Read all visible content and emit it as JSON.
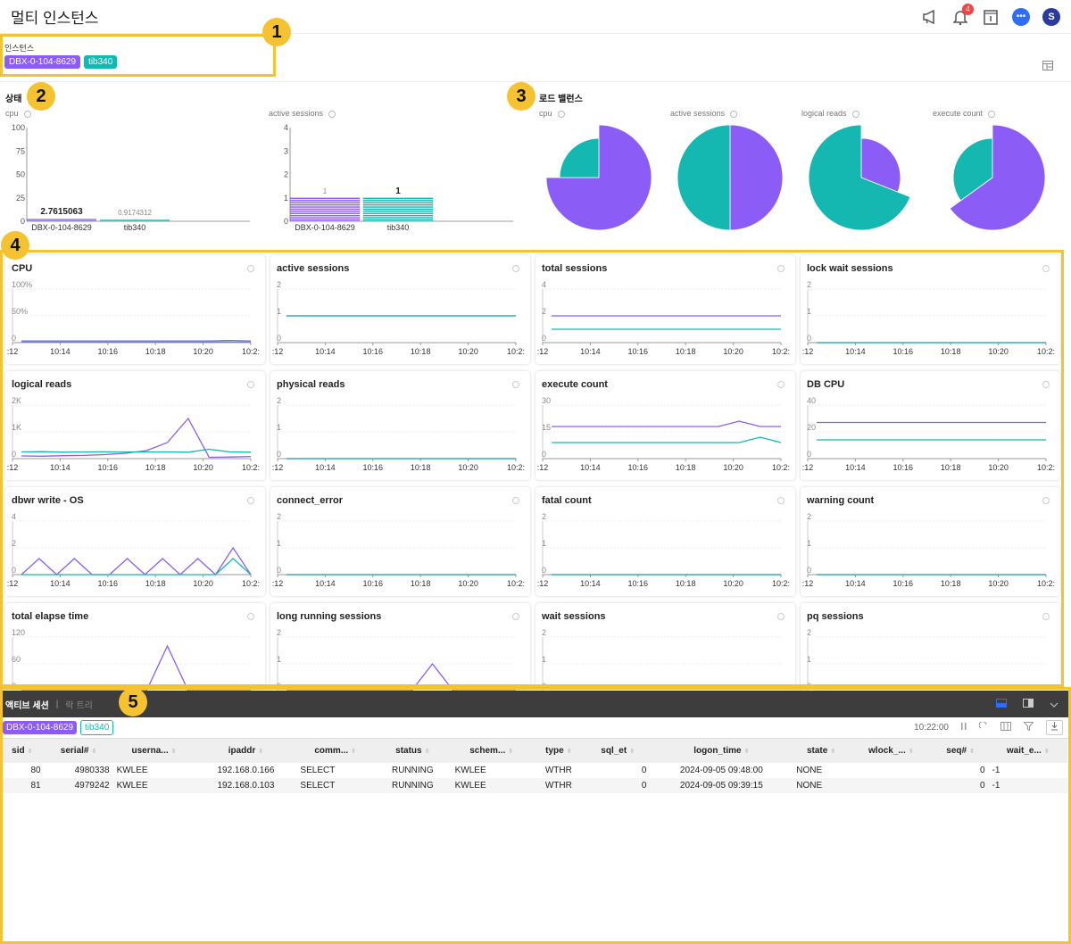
{
  "header": {
    "title": "멀티 인스턴스",
    "notification_count": "4",
    "avatar_letter": "S",
    "chat_glyph": "•••"
  },
  "instances": {
    "label": "인스턴스",
    "tags": [
      "DBX-0-104-8629",
      "tib340"
    ]
  },
  "colors": {
    "purple": "#8b5cf6",
    "teal": "#14b8b0",
    "callout": "#f5c232"
  },
  "callouts": [
    "1",
    "2",
    "3",
    "4",
    "5"
  ],
  "status": {
    "title": "상태",
    "cpu": {
      "label": "cpu",
      "yticks": [
        "100",
        "75",
        "50",
        "25",
        "0"
      ],
      "ymax": 100,
      "categories": [
        "DBX-0-104-8629",
        "tib340"
      ],
      "values": [
        2.7615063,
        0.9174312
      ],
      "value_labels": [
        "2.7615063",
        "0.9174312"
      ]
    },
    "active": {
      "label": "active sessions",
      "yticks": [
        "4",
        "3",
        "2",
        "1",
        "0"
      ],
      "ymax": 4,
      "categories": [
        "DBX-0-104-8629",
        "tib340"
      ],
      "values": [
        1,
        1
      ],
      "value_labels": [
        "1",
        "1"
      ]
    }
  },
  "load_balance": {
    "title": "로드 밸런스",
    "pies": [
      {
        "label": "cpu",
        "purple_fraction": 0.75
      },
      {
        "label": "active sessions",
        "purple_fraction": 0.5
      },
      {
        "label": "logical reads",
        "purple_fraction": 0.31
      },
      {
        "label": "execute count",
        "purple_fraction": 0.65
      }
    ]
  },
  "chart_data": [
    {
      "type": "line",
      "title": "CPU",
      "yticks": [
        "100%",
        "50%",
        "0"
      ],
      "ymax": 100,
      "xticks": [
        ":12",
        "10:14",
        "10:16",
        "10:18",
        "10:20",
        "10:2:"
      ],
      "series": [
        {
          "name": "DBX-0-104-8629",
          "values": [
            3,
            3,
            3,
            3,
            3,
            3,
            3,
            3,
            3,
            3,
            4,
            3
          ]
        },
        {
          "name": "tib340",
          "values": [
            1,
            1,
            1,
            1,
            1,
            1,
            1,
            1,
            1,
            1,
            1,
            1
          ]
        }
      ]
    },
    {
      "type": "line",
      "title": "active sessions",
      "yticks": [
        "2",
        "1",
        "0"
      ],
      "ymax": 2,
      "xticks": [
        ":12",
        "10:14",
        "10:16",
        "10:18",
        "10:20",
        "10:2:"
      ],
      "series": [
        {
          "name": "DBX-0-104-8629",
          "values": [
            1,
            1,
            1,
            1,
            1,
            1,
            1,
            1,
            1,
            1,
            1,
            1
          ]
        },
        {
          "name": "tib340",
          "values": [
            1,
            1,
            1,
            1,
            1,
            1,
            1,
            1,
            1,
            1,
            1,
            1
          ]
        }
      ]
    },
    {
      "type": "line",
      "title": "total sessions",
      "yticks": [
        "4",
        "2",
        "0"
      ],
      "ymax": 4,
      "xticks": [
        ":12",
        "10:14",
        "10:16",
        "10:18",
        "10:20",
        "10:2:"
      ],
      "series": [
        {
          "name": "DBX-0-104-8629",
          "values": [
            2,
            2,
            2,
            2,
            2,
            2,
            2,
            2,
            2,
            2,
            2,
            2
          ]
        },
        {
          "name": "tib340",
          "values": [
            1,
            1,
            1,
            1,
            1,
            1,
            1,
            1,
            1,
            1,
            1,
            1
          ]
        }
      ]
    },
    {
      "type": "line",
      "title": "lock wait sessions",
      "yticks": [
        "2",
        "1",
        "0"
      ],
      "ymax": 2,
      "xticks": [
        ":12",
        "10:14",
        "10:16",
        "10:18",
        "10:20",
        "10:2:"
      ],
      "series": [
        {
          "name": "DBX-0-104-8629",
          "values": [
            0,
            0,
            0,
            0,
            0,
            0,
            0,
            0,
            0,
            0,
            0,
            0
          ]
        },
        {
          "name": "tib340",
          "values": [
            0,
            0,
            0,
            0,
            0,
            0,
            0,
            0,
            0,
            0,
            0,
            0
          ]
        }
      ]
    },
    {
      "type": "line",
      "title": "logical reads",
      "yticks": [
        "2K",
        "1K",
        "0"
      ],
      "ymax": 2000,
      "xticks": [
        ":12",
        "10:14",
        "10:16",
        "10:18",
        "10:20",
        "10:2:"
      ],
      "series": [
        {
          "name": "DBX-0-104-8629",
          "values": [
            100,
            90,
            110,
            120,
            150,
            200,
            300,
            600,
            1500,
            50,
            60,
            80
          ]
        },
        {
          "name": "tib340",
          "values": [
            250,
            260,
            240,
            250,
            255,
            245,
            250,
            250,
            240,
            350,
            250,
            240
          ]
        }
      ]
    },
    {
      "type": "line",
      "title": "physical reads",
      "yticks": [
        "2",
        "1",
        "0"
      ],
      "ymax": 2,
      "xticks": [
        ":12",
        "10:14",
        "10:16",
        "10:18",
        "10:20",
        "10:2:"
      ],
      "series": [
        {
          "name": "DBX-0-104-8629",
          "values": [
            0,
            0,
            0,
            0,
            0,
            0,
            0,
            0,
            0,
            0,
            0,
            0
          ]
        },
        {
          "name": "tib340",
          "values": [
            0,
            0,
            0,
            0,
            0,
            0,
            0,
            0,
            0,
            0,
            0,
            0
          ]
        }
      ]
    },
    {
      "type": "line",
      "title": "execute count",
      "yticks": [
        "30",
        "15",
        "0"
      ],
      "ymax": 30,
      "xticks": [
        ":12",
        "10:14",
        "10:16",
        "10:18",
        "10:20",
        "10:2:"
      ],
      "series": [
        {
          "name": "DBX-0-104-8629",
          "values": [
            18,
            18,
            18,
            18,
            18,
            18,
            18,
            18,
            18,
            21,
            18,
            18
          ]
        },
        {
          "name": "tib340",
          "values": [
            9,
            9,
            9,
            9,
            9,
            9,
            9,
            9,
            9,
            9,
            12,
            9
          ]
        }
      ]
    },
    {
      "type": "line",
      "title": "DB CPU",
      "yticks": [
        "40",
        "20",
        "0"
      ],
      "ymax": 40,
      "xticks": [
        ":12",
        "10:14",
        "10:16",
        "10:18",
        "10:20",
        "10:2:"
      ],
      "series": [
        {
          "name": "DBX-0-104-8629",
          "values": [
            27,
            27,
            27,
            27,
            27,
            27,
            27,
            27,
            27,
            27,
            27,
            27
          ]
        },
        {
          "name": "tib340",
          "values": [
            14,
            14,
            14,
            14,
            14,
            14,
            14,
            14,
            14,
            14,
            14,
            14
          ]
        }
      ]
    },
    {
      "type": "line",
      "title": "dbwr write - OS",
      "yticks": [
        "4",
        "2",
        "0"
      ],
      "ymax": 4,
      "xticks": [
        ":12",
        "10:14",
        "10:16",
        "10:18",
        "10:20",
        "10:2:"
      ],
      "series": [
        {
          "name": "DBX-0-104-8629",
          "values": [
            0,
            1.2,
            0,
            1.2,
            0,
            0,
            1.2,
            0,
            1.2,
            0,
            1.2,
            0,
            2,
            0
          ]
        },
        {
          "name": "tib340",
          "values": [
            0,
            0,
            0,
            0,
            0,
            0,
            0,
            0,
            0,
            0,
            0,
            0,
            1.2,
            0
          ]
        }
      ]
    },
    {
      "type": "line",
      "title": "connect_error",
      "yticks": [
        "2",
        "1",
        "0"
      ],
      "ymax": 2,
      "xticks": [
        ":12",
        "10:14",
        "10:16",
        "10:18",
        "10:20",
        "10:2:"
      ],
      "series": [
        {
          "name": "DBX-0-104-8629",
          "values": [
            0,
            0,
            0,
            0,
            0,
            0,
            0,
            0,
            0,
            0,
            0,
            0
          ]
        },
        {
          "name": "tib340",
          "values": [
            0,
            0,
            0,
            0,
            0,
            0,
            0,
            0,
            0,
            0,
            0,
            0
          ]
        }
      ]
    },
    {
      "type": "line",
      "title": "fatal count",
      "yticks": [
        "2",
        "1",
        "0"
      ],
      "ymax": 2,
      "xticks": [
        ":12",
        "10:14",
        "10:16",
        "10:18",
        "10:20",
        "10:2:"
      ],
      "series": [
        {
          "name": "DBX-0-104-8629",
          "values": [
            0,
            0,
            0,
            0,
            0,
            0,
            0,
            0,
            0,
            0,
            0,
            0
          ]
        },
        {
          "name": "tib340",
          "values": [
            0,
            0,
            0,
            0,
            0,
            0,
            0,
            0,
            0,
            0,
            0,
            0
          ]
        }
      ]
    },
    {
      "type": "line",
      "title": "warning count",
      "yticks": [
        "2",
        "1",
        "0"
      ],
      "ymax": 2,
      "xticks": [
        ":12",
        "10:14",
        "10:16",
        "10:18",
        "10:20",
        "10:2:"
      ],
      "series": [
        {
          "name": "DBX-0-104-8629",
          "values": [
            0,
            0,
            0,
            0,
            0,
            0,
            0,
            0,
            0,
            0,
            0,
            0
          ]
        },
        {
          "name": "tib340",
          "values": [
            0,
            0,
            0,
            0,
            0,
            0,
            0,
            0,
            0,
            0,
            0,
            0
          ]
        }
      ]
    },
    {
      "type": "line",
      "title": "total elapse time",
      "yticks": [
        "120",
        "60",
        "0"
      ],
      "ymax": 120,
      "xticks": [],
      "series": [
        {
          "name": "DBX-0-104-8629",
          "values": [
            0,
            0,
            0,
            0,
            0,
            0,
            0,
            100,
            0,
            0,
            0,
            0
          ]
        }
      ]
    },
    {
      "type": "line",
      "title": "long running sessions",
      "yticks": [
        "2",
        "1",
        "0"
      ],
      "ymax": 2,
      "xticks": [],
      "series": [
        {
          "name": "DBX-0-104-8629",
          "values": [
            0,
            0,
            0,
            0,
            0,
            0,
            0,
            1,
            0,
            0,
            0,
            0
          ]
        }
      ]
    },
    {
      "type": "line",
      "title": "wait sessions",
      "yticks": [
        "2",
        "1",
        "0"
      ],
      "ymax": 2,
      "xticks": [],
      "series": []
    },
    {
      "type": "line",
      "title": "pq sessions",
      "yticks": [
        "2",
        "1",
        "0"
      ],
      "ymax": 2,
      "xticks": [],
      "series": []
    }
  ],
  "bottom": {
    "tabs": [
      "액티브 세션",
      "락 트리"
    ],
    "tags": [
      "DBX-0-104-8629",
      "tib340"
    ],
    "time": "10:22:00",
    "columns": [
      "sid",
      "serial#",
      "userna...",
      "ipaddr",
      "comm...",
      "status",
      "schem...",
      "type",
      "sql_et",
      "logon_time",
      "state",
      "wlock_...",
      "seq#",
      "wait_e..."
    ],
    "rows": [
      [
        "80",
        "4980338",
        "KWLEE",
        "192.168.0.166",
        "SELECT",
        "RUNNING",
        "KWLEE",
        "WTHR",
        "0",
        "2024-09-05 09:48:00",
        "NONE",
        "",
        "0",
        "-1"
      ],
      [
        "81",
        "4979242",
        "KWLEE",
        "192.168.0.103",
        "SELECT",
        "RUNNING",
        "KWLEE",
        "WTHR",
        "0",
        "2024-09-05 09:39:15",
        "NONE",
        "",
        "0",
        "-1"
      ]
    ]
  }
}
